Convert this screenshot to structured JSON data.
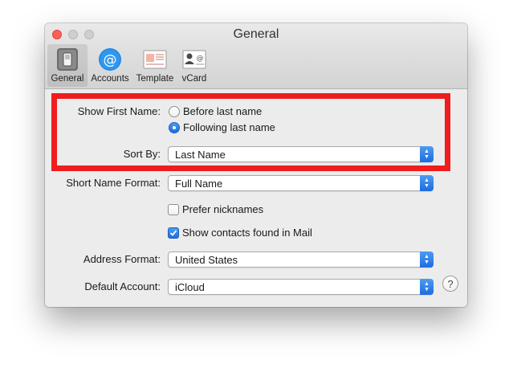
{
  "window": {
    "title": "General"
  },
  "toolbar": {
    "tabs": [
      {
        "label": "General",
        "icon": "general-switch-icon",
        "selected": true
      },
      {
        "label": "Accounts",
        "icon": "at-sign-icon",
        "selected": false
      },
      {
        "label": "Template",
        "icon": "template-card-icon",
        "selected": false
      },
      {
        "label": "vCard",
        "icon": "vcard-icon",
        "selected": false
      }
    ]
  },
  "form": {
    "show_first_name_label": "Show First Name:",
    "show_first_name_options": [
      {
        "label": "Before last name",
        "selected": false
      },
      {
        "label": "Following last name",
        "selected": true
      }
    ],
    "sort_by_label": "Sort By:",
    "sort_by_value": "Last Name",
    "short_name_format_label": "Short Name Format:",
    "short_name_format_value": "Full Name",
    "prefer_nicknames_label": "Prefer nicknames",
    "prefer_nicknames_checked": false,
    "show_contacts_mail_label": "Show contacts found in Mail",
    "show_contacts_mail_checked": true,
    "address_format_label": "Address Format:",
    "address_format_value": "United States",
    "default_account_label": "Default Account:",
    "default_account_value": "iCloud",
    "help_label": "?"
  },
  "colors": {
    "accent": "#1f6fe0",
    "highlight": "#ef1d1d",
    "close_button": "#fc5f57"
  }
}
